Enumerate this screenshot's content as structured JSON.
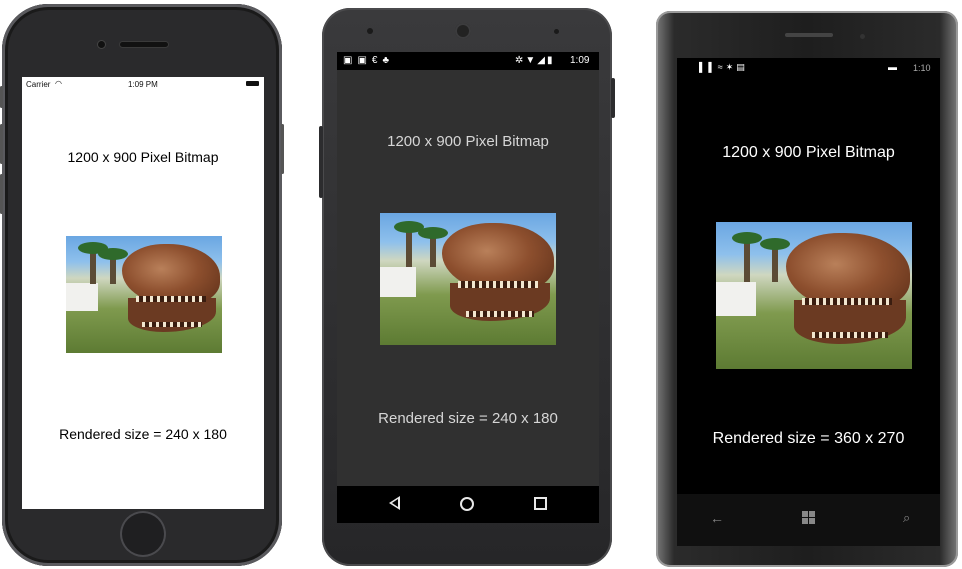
{
  "phones": [
    {
      "platform": "iOS",
      "status_bar": {
        "carrier": "Carrier",
        "time": "1:09 PM"
      },
      "title": "1200 x 900 Pixel Bitmap",
      "caption": "Rendered size = 240 x 180"
    },
    {
      "platform": "Android",
      "status_bar": {
        "time": "1:09"
      },
      "title": "1200 x 900 Pixel Bitmap",
      "caption": "Rendered size = 240 x 180",
      "nav_icons": [
        "back-icon",
        "home-icon",
        "recents-icon"
      ]
    },
    {
      "platform": "Windows Phone",
      "status_bar": {
        "time": "1:10"
      },
      "title": "1200 x 900 Pixel Bitmap",
      "caption": "Rendered size = 360 x 270",
      "nav_icons": [
        "back-arrow-icon",
        "windows-start-icon",
        "search-icon"
      ]
    }
  ],
  "colors": {
    "ios_screen": "#ffffff",
    "android_screen": "#303030",
    "android_nav": "#000000",
    "wp_screen": "#000000",
    "phone_body_dark": "#1c1c1e"
  }
}
